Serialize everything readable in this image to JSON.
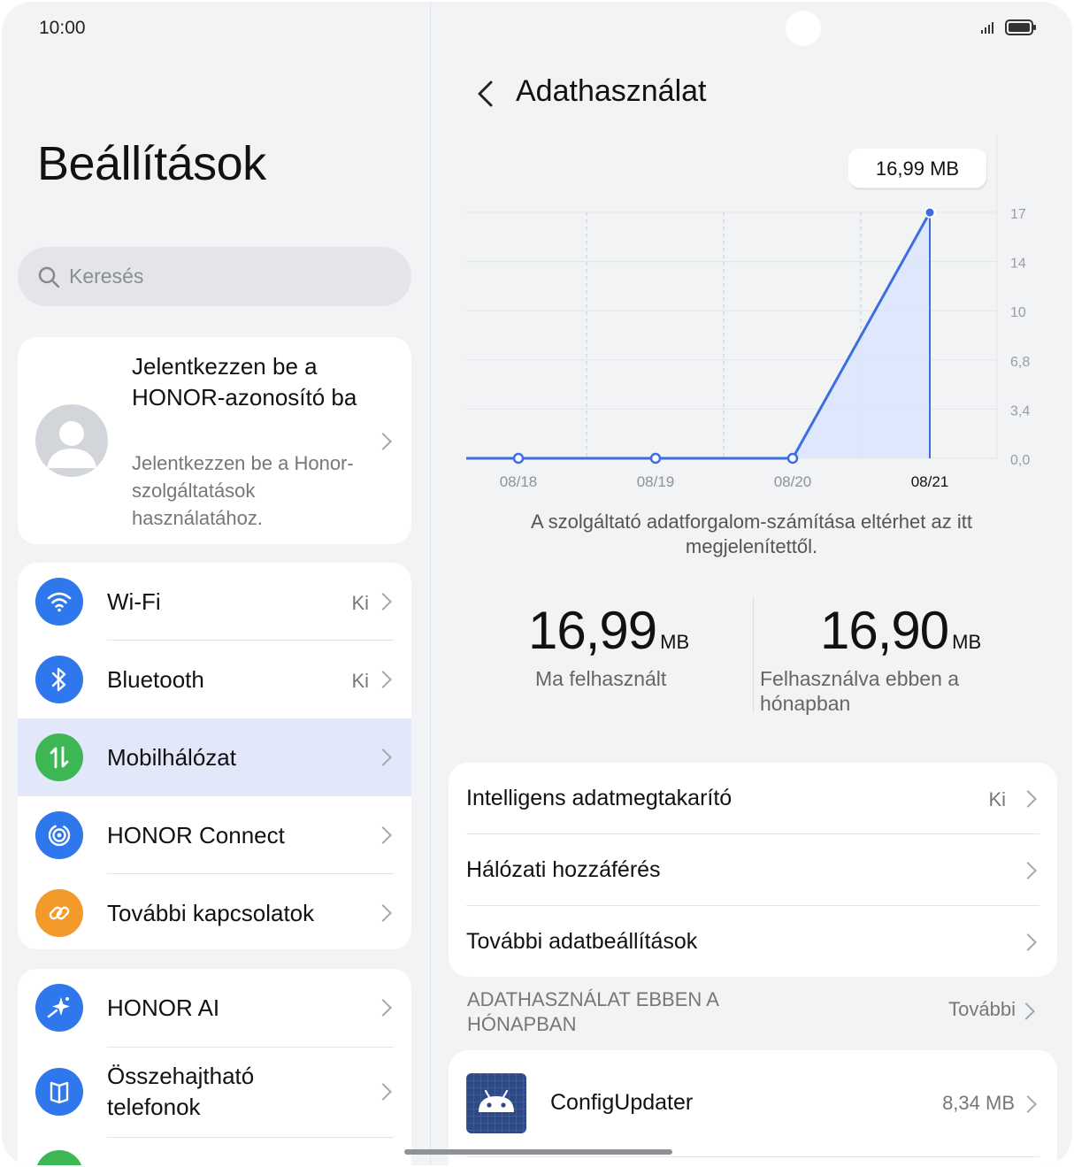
{
  "status_bar": {
    "time": "10:00"
  },
  "settings": {
    "title": "Beállítások",
    "search_placeholder": "Keresés",
    "account": {
      "title": "Jelentkezzen be a HONOR-azonosító ba",
      "subtitle": "Jelentkezzen be a Honor-szolgáltatások használatához."
    },
    "group1": [
      {
        "label": "Wi-Fi",
        "value": "Ki",
        "icon": "wifi-icon"
      },
      {
        "label": "Bluetooth",
        "value": "Ki",
        "icon": "bluetooth-icon"
      },
      {
        "label": "Mobilhálózat",
        "value": "",
        "icon": "mobile-data-icon"
      },
      {
        "label": "HONOR Connect",
        "value": "",
        "icon": "honor-connect-icon"
      },
      {
        "label": "További kapcsolatok",
        "value": "",
        "icon": "link-icon"
      }
    ],
    "group2": [
      {
        "label": "HONOR AI",
        "icon": "sparkle-icon"
      },
      {
        "label": "Összehajtható telefonok",
        "icon": "foldable-icon"
      }
    ]
  },
  "detail": {
    "title": "Adathasználat",
    "note": "A szolgáltató adatforgalom-számítása eltérhet az itt megjelenítettől.",
    "today": {
      "value": "16,99",
      "unit": "MB",
      "label": "Ma felhasznált"
    },
    "month": {
      "value": "16,90",
      "unit": "MB",
      "label": "Felhasználva ebben a hónapban"
    },
    "settings": [
      {
        "label": "Intelligens adatmegtakarító",
        "value": "Ki"
      },
      {
        "label": "Hálózati hozzáférés",
        "value": ""
      },
      {
        "label": "További adatbeállítások",
        "value": ""
      }
    ],
    "section_title": "Adathasználat ebben a hónapban",
    "section_more": "További",
    "apps": [
      {
        "name": "ConfigUpdater",
        "size": "8,34 MB"
      }
    ]
  },
  "chart_data": {
    "type": "area",
    "categories": [
      "08/18",
      "08/19",
      "08/20",
      "08/21"
    ],
    "values": [
      0,
      0,
      0,
      16.99
    ],
    "ytick_labels": [
      "0,0",
      "3,4",
      "6,8",
      "10",
      "14",
      "17"
    ],
    "ylim": [
      0,
      17
    ],
    "tooltip": "16,99 MB",
    "selected": "08/21",
    "colors": {
      "line": "#3c6ee0",
      "fill": "#dbe4fb"
    }
  }
}
